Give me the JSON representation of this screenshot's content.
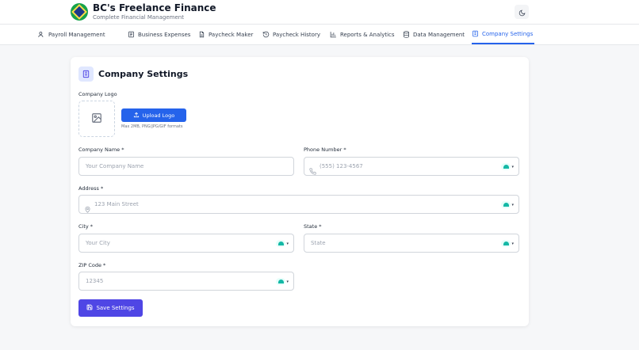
{
  "header": {
    "app_title": "BC's Freelance Finance",
    "app_subtitle": "Complete Financial Management"
  },
  "tabs": [
    {
      "label": "Payroll Management",
      "icon": "users-icon"
    },
    {
      "label": "Business Expenses",
      "icon": "receipt-icon"
    },
    {
      "label": "Paycheck Maker",
      "icon": "document-icon"
    },
    {
      "label": "Paycheck History",
      "icon": "history-icon"
    },
    {
      "label": "Reports & Analytics",
      "icon": "bar-chart-icon"
    },
    {
      "label": "Data Management",
      "icon": "database-icon"
    },
    {
      "label": "Company Settings",
      "icon": "building-icon",
      "active": true
    }
  ],
  "card": {
    "title": "Company Settings",
    "logo": {
      "label": "Company Logo",
      "upload_label": "Upload Logo",
      "hint": "Max 2MB, PNG/JPG/GIF formats"
    },
    "fields": {
      "company_name": {
        "label": "Company Name *",
        "placeholder": "Your Company Name"
      },
      "phone": {
        "label": "Phone Number *",
        "placeholder": "(555) 123-4567"
      },
      "address": {
        "label": "Address *",
        "placeholder": "123 Main Street"
      },
      "city": {
        "label": "City *",
        "placeholder": "Your City"
      },
      "state": {
        "label": "State *",
        "placeholder": "State"
      },
      "zip": {
        "label": "ZIP Code *",
        "placeholder": "12345"
      }
    },
    "save_label": "Save Settings"
  },
  "colors": {
    "accent": "#2563eb",
    "save_button": "#4f46e5",
    "page_bg": "#f6f7f9"
  }
}
